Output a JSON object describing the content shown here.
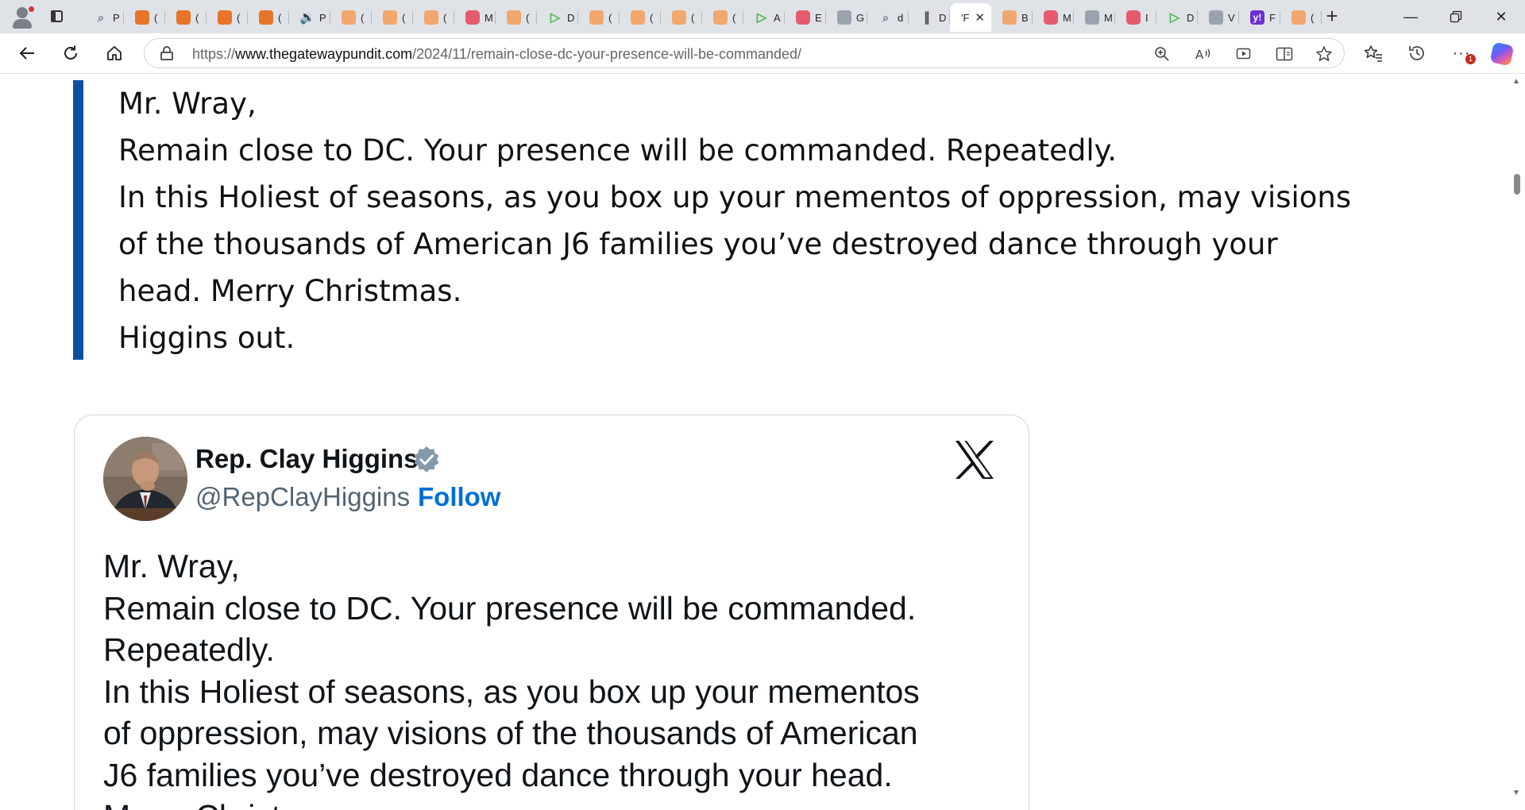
{
  "browser": {
    "tabs": [
      {
        "icon": "search-icon",
        "kind": "search",
        "label": "P"
      },
      {
        "icon": "bookmark-icon",
        "kind": "orange",
        "label": "("
      },
      {
        "icon": "bookmark-icon",
        "kind": "orange",
        "label": "("
      },
      {
        "icon": "bookmark-icon",
        "kind": "orange",
        "label": "("
      },
      {
        "icon": "bookmark-icon",
        "kind": "orange",
        "label": "("
      },
      {
        "icon": "speaker-icon",
        "kind": "audio",
        "label": "P"
      },
      {
        "icon": "bookmark-icon",
        "kind": "orange-light",
        "label": "("
      },
      {
        "icon": "bookmark-icon",
        "kind": "orange-light",
        "label": "("
      },
      {
        "icon": "bookmark-icon",
        "kind": "orange-light",
        "label": "("
      },
      {
        "icon": "youtube-icon",
        "kind": "yt",
        "label": "M"
      },
      {
        "icon": "bookmark-icon",
        "kind": "orange-light",
        "label": "("
      },
      {
        "icon": "play-icon",
        "kind": "play",
        "label": "D"
      },
      {
        "icon": "bookmark-icon",
        "kind": "orange-light",
        "label": "("
      },
      {
        "icon": "bookmark-icon",
        "kind": "orange-light",
        "label": "("
      },
      {
        "icon": "bookmark-icon",
        "kind": "orange-light",
        "label": "("
      },
      {
        "icon": "bookmark-icon",
        "kind": "orange-light",
        "label": "("
      },
      {
        "icon": "play-icon",
        "kind": "play",
        "label": "A"
      },
      {
        "icon": "youtube-icon",
        "kind": "yt",
        "label": "E"
      },
      {
        "icon": "generic-icon",
        "kind": "generic",
        "label": "G"
      },
      {
        "icon": "search-icon",
        "kind": "search",
        "label": "d"
      },
      {
        "icon": "hands-icon",
        "kind": "hands",
        "label": "D"
      },
      {
        "icon": "close-icon",
        "kind": "active",
        "label": "'F"
      },
      {
        "icon": "bookmark-icon",
        "kind": "orange-light",
        "label": "B"
      },
      {
        "icon": "youtube-icon",
        "kind": "yt",
        "label": "M"
      },
      {
        "icon": "generic-icon",
        "kind": "generic",
        "label": "M"
      },
      {
        "icon": "youtube-icon",
        "kind": "yt",
        "label": "I"
      },
      {
        "icon": "play-icon",
        "kind": "play",
        "label": "D"
      },
      {
        "icon": "generic-icon",
        "kind": "generic",
        "label": "V"
      },
      {
        "icon": "yahoo-icon",
        "kind": "yahoo",
        "label": "F"
      },
      {
        "icon": "bookmark-icon",
        "kind": "orange-light",
        "label": "("
      }
    ],
    "yahoo_glyph": "y!",
    "url_scheme": "https://",
    "url_host": "www.thegatewaypundit.com",
    "url_path": "/2024/11/remain-close-dc-your-presence-will-be-commanded/",
    "notification_count": "1"
  },
  "article": {
    "quote_lines": [
      "Mr. Wray,",
      "Remain close to DC. Your presence will be commanded. Repeatedly.",
      "In this Holiest of seasons, as you box up your mementos of oppression, may visions",
      "of the thousands of American J6 families you’ve destroyed dance through your",
      "head. Merry Christmas.",
      "Higgins out."
    ],
    "quote_bar_color": "#0b4fa0"
  },
  "tweet": {
    "name": "Rep. Clay Higgins",
    "handle": "@RepClayHiggins",
    "separator": "·",
    "follow_label": "Follow",
    "follow_color": "#006fd6",
    "body_lines": [
      "Mr. Wray,",
      "  Remain close to DC. Your presence will be commanded.",
      "Repeatedly.",
      "  In this Holiest of seasons, as you box up your mementos",
      "of oppression, may visions of the thousands of American",
      "J6 families you’ve destroyed dance through your head.",
      "Merry Christ"
    ]
  }
}
